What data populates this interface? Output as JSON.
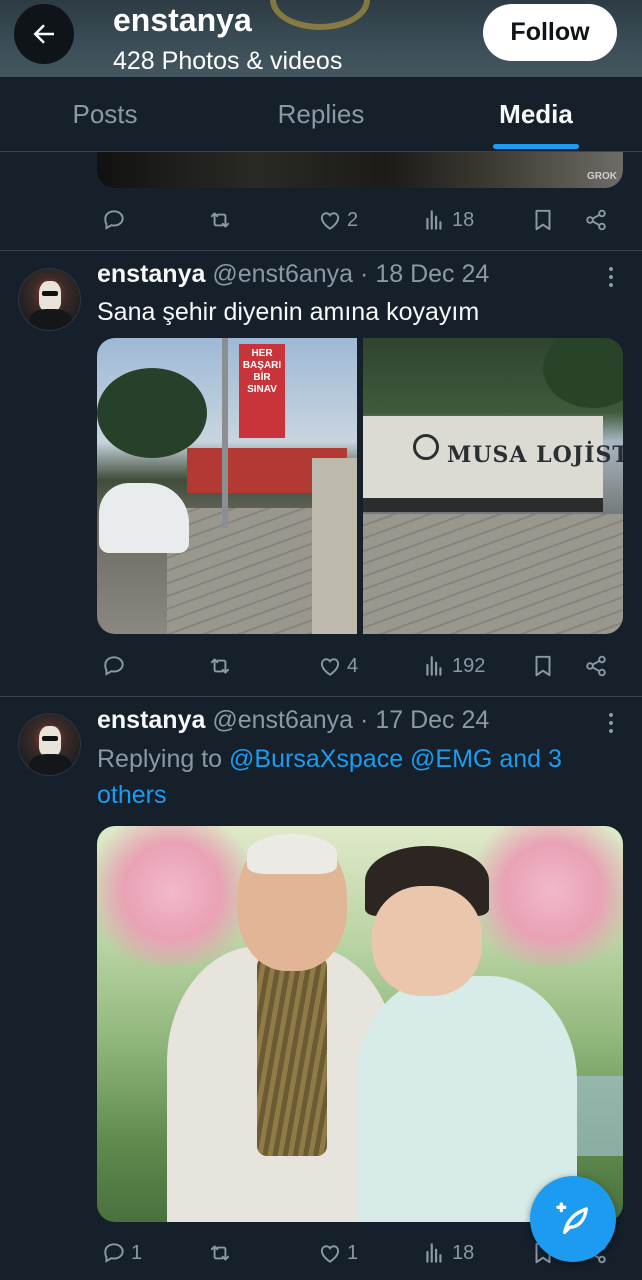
{
  "header": {
    "name": "enstanya",
    "count": "428 Photos & videos",
    "follow_label": "Follow"
  },
  "tabs": [
    "Posts",
    "Replies",
    "Media"
  ],
  "active_tab": "Media",
  "media_top_watermark": "GROK",
  "posts": [
    {
      "actions": {
        "replies": "",
        "reposts": "",
        "likes": "2",
        "views": "18"
      }
    },
    {
      "author": "enstanya",
      "handle": "@enst6anya",
      "date": "18 Dec 24",
      "separator": "·",
      "text": "Sana şehir diyenin amına koyayım",
      "image_sign": [
        "HER",
        "BAŞARI",
        "BİR",
        "SINAV"
      ],
      "truck_text": "MUSA LOJİSTİ",
      "actions": {
        "replies": "",
        "reposts": "",
        "likes": "4",
        "views": "192"
      }
    },
    {
      "author": "enstanya",
      "handle": "@enst6anya",
      "date": "17 Dec 24",
      "separator": "·",
      "reply_prefix": "Replying to",
      "reply_targets": "@BursaXspace @EMG and 3 others",
      "actions": {
        "replies": "1",
        "reposts": "",
        "likes": "1",
        "views": "18"
      }
    }
  ],
  "icons": {
    "back": "arrow-left-icon",
    "reply": "reply-icon",
    "repost": "repost-icon",
    "like": "heart-icon",
    "views": "views-icon",
    "bookmark": "bookmark-icon",
    "share": "share-icon",
    "more": "more-icon",
    "compose": "compose-icon"
  },
  "colors": {
    "background": "#15202b",
    "accent": "#1d9bf0",
    "muted": "#8b98a5"
  }
}
